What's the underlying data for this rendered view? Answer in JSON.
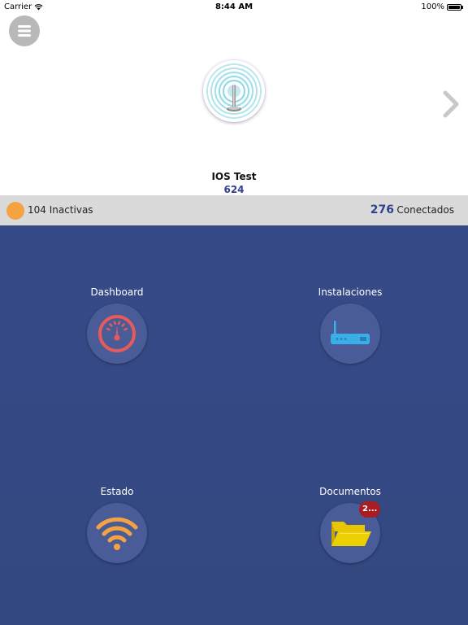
{
  "status_bar": {
    "carrier": "Carrier",
    "time": "8:44 AM",
    "battery": "100%"
  },
  "header": {
    "device_name": "IOS Test",
    "device_code": "624"
  },
  "summary": {
    "inactive_label": "104 Inactivas",
    "connected_count": "276",
    "connected_label": "Conectados"
  },
  "tiles": [
    {
      "label": "Dashboard",
      "icon": "speedometer-icon"
    },
    {
      "label": "Instalaciones",
      "icon": "router-icon"
    },
    {
      "label": "Estado",
      "icon": "wifi-icon"
    },
    {
      "label": "Documentos",
      "icon": "folder-icon",
      "badge": "2..."
    }
  ],
  "colors": {
    "panel": "#364a8a",
    "accent_blue": "#2f4290",
    "inactive_orange": "#f4a340",
    "dashboard_red": "#e85a5a",
    "router_cyan": "#3aaee6",
    "wifi_orange": "#f4a340",
    "folder_yellow": "#e9c400",
    "badge_red": "#a91c22"
  }
}
